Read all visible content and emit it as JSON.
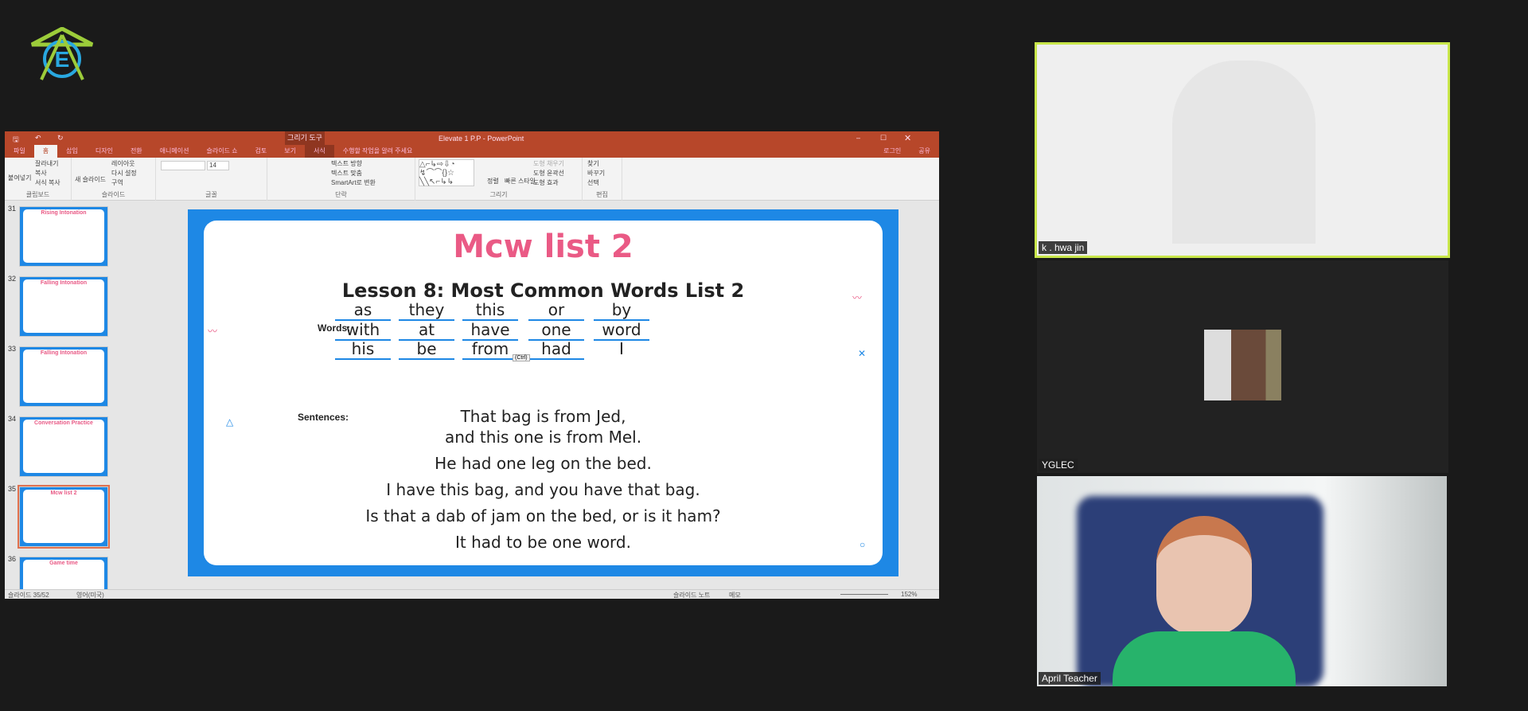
{
  "window": {
    "title": "Elevate 1 P.P - PowerPoint",
    "login": "로그인",
    "share": "공유",
    "ctx_tool": "그리기 도구"
  },
  "tabs": [
    "파일",
    "홈",
    "삽입",
    "디자인",
    "전환",
    "애니메이션",
    "슬라이드 쇼",
    "검토",
    "보기",
    "서식"
  ],
  "tell_me": "수행할 작업을 알려 주세요",
  "ribbon": {
    "clipboard": {
      "label": "클립보드",
      "paste": "붙여넣기",
      "cut": "잘라내기",
      "copy": "복사",
      "format": "서식 복사"
    },
    "slides": {
      "label": "슬라이드",
      "new": "새 슬라이드",
      "layout": "레이아웃",
      "reset": "다시 설정",
      "section": "구역"
    },
    "font": {
      "label": "글꼴",
      "size": "14"
    },
    "paragraph": {
      "label": "단락",
      "dir": "텍스트 방향",
      "align": "텍스트 맞춤",
      "smartart": "SmartArt로 변환"
    },
    "drawing": {
      "label": "그리기",
      "arrange": "정렬",
      "styles": "빠른 스타일",
      "fill": "도형 채우기",
      "outline": "도형 윤곽선",
      "effect": "도형 효과"
    },
    "editing": {
      "label": "편집",
      "find": "찾기",
      "replace": "바꾸기",
      "select": "선택"
    }
  },
  "thumbnails": [
    {
      "num": "31",
      "title": "Rising Intonation"
    },
    {
      "num": "32",
      "title": "Falling Intonation"
    },
    {
      "num": "33",
      "title": "Falling Intonation"
    },
    {
      "num": "34",
      "title": "Conversation Practice"
    },
    {
      "num": "35",
      "title": "Mcw list 2",
      "selected": true
    },
    {
      "num": "36",
      "title": "Game time"
    }
  ],
  "slide": {
    "title": "Mcw list 2",
    "lesson": "Lesson 8: Most Common Words List 2",
    "words_label": "Words:",
    "words": [
      [
        "as",
        "they",
        "this",
        "or",
        "by"
      ],
      [
        "with",
        "at",
        "have",
        "one",
        "word"
      ],
      [
        "his",
        "be",
        "from",
        "had",
        "I"
      ]
    ],
    "sentences_label": "Sentences:",
    "sentences": [
      "That bag is from Jed,",
      "and this one is from Mel.",
      "He had one leg on the bed.",
      "I have this bag, and you have that bag.",
      "Is that a dab of jam on the bed, or is it ham?",
      "It had to be one word."
    ],
    "paste_tag": "(Ctrl)"
  },
  "status": {
    "slide": "슬라이드 35/52",
    "lang": "영어(미국)",
    "notes": "슬라이드 노트",
    "comments": "메모",
    "zoom": "152%"
  },
  "participants": [
    {
      "name": "k . hwa jin",
      "active": true
    },
    {
      "name": "YGLEC"
    },
    {
      "name": "April Teacher"
    }
  ],
  "colors": {
    "ppt_accent": "#b7472a",
    "slide_blue": "#1e88e5",
    "title_pink": "#ea5a85",
    "active_speaker": "#c8e64a"
  }
}
